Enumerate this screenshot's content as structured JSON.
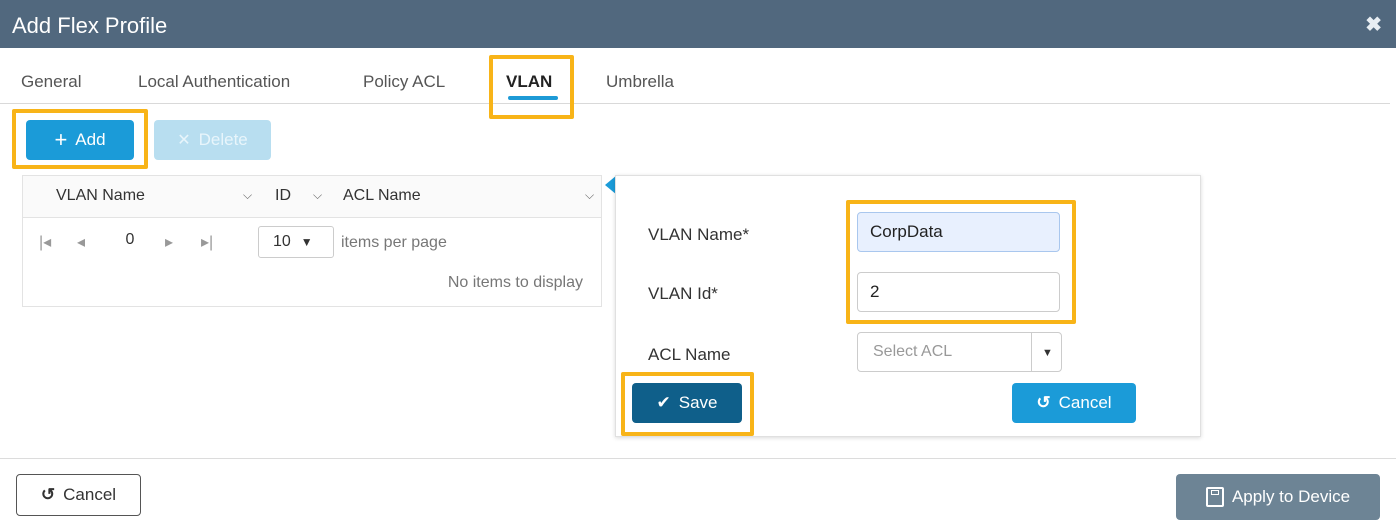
{
  "window": {
    "title": "Add Flex Profile",
    "close_glyph": "✖"
  },
  "tabs": [
    {
      "label": "General"
    },
    {
      "label": "Local Authentication"
    },
    {
      "label": "Policy ACL"
    },
    {
      "label": "VLAN",
      "active": true
    },
    {
      "label": "Umbrella"
    }
  ],
  "toolbar": {
    "add_label": "Add",
    "add_icon": "plus-icon",
    "delete_label": "Delete",
    "delete_icon": "x-icon"
  },
  "grid": {
    "columns": [
      "VLAN Name",
      "ID",
      "ACL Name"
    ],
    "pager": {
      "page": "0",
      "page_size": "10",
      "items_per_page": "items per page"
    },
    "empty_text": "No items to display"
  },
  "form": {
    "vlan_name_label": "VLAN Name*",
    "vlan_name_value": "CorpData",
    "vlan_id_label": "VLAN Id*",
    "vlan_id_value": "2",
    "acl_label": "ACL Name",
    "acl_placeholder": "Select ACL",
    "save_label": "Save",
    "save_icon": "check-icon",
    "cancel_label": "Cancel",
    "cancel_icon": "undo-icon"
  },
  "footer": {
    "cancel_label": "Cancel",
    "apply_label": "Apply to Device",
    "apply_icon": "save-disk-icon"
  },
  "colors": {
    "titlebar": "#51687e",
    "primary": "#1b9bd8",
    "highlight": "#f8b418",
    "save_dark": "#0f5f8a",
    "apply_gray": "#6d8495"
  }
}
